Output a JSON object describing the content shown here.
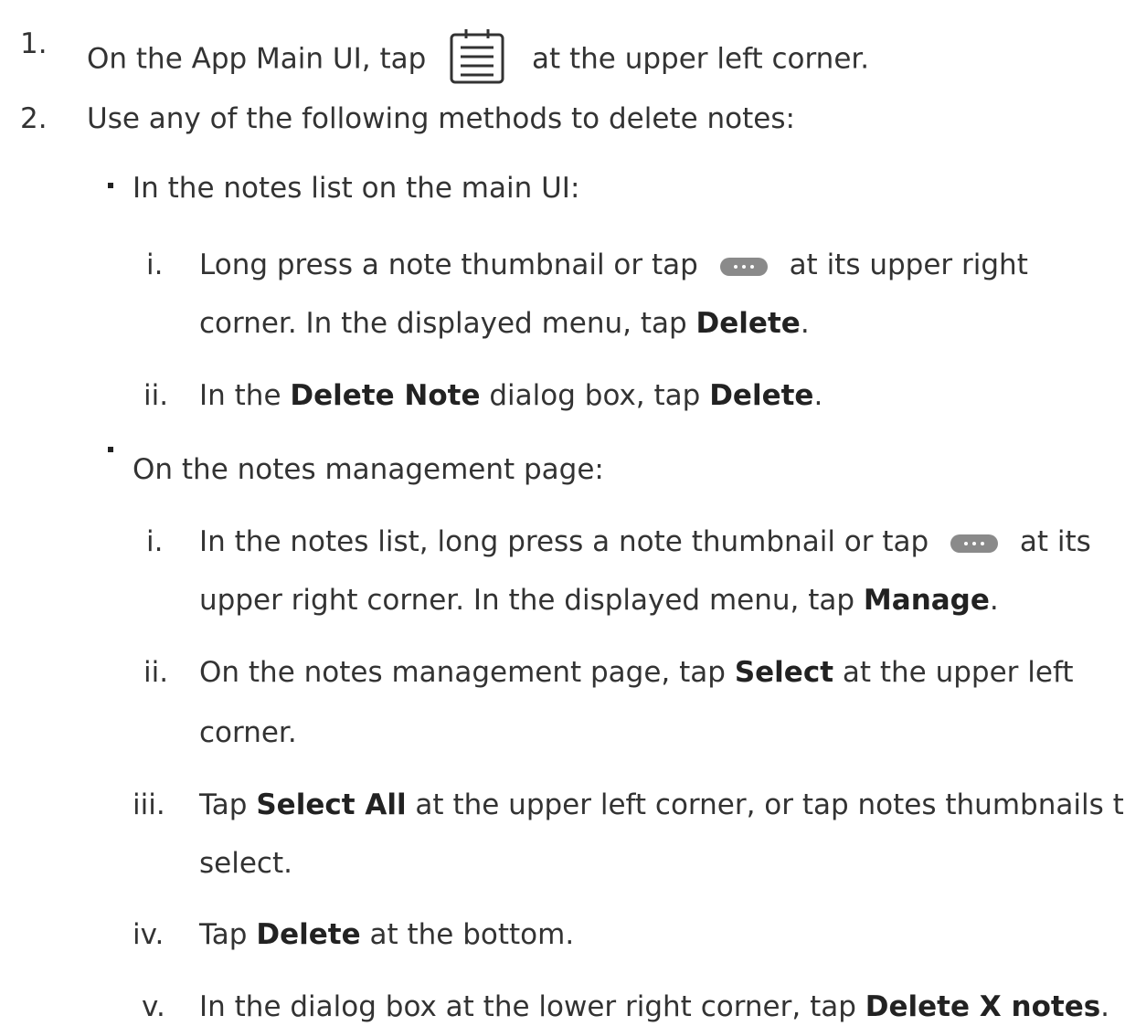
{
  "step1": {
    "num": "1.",
    "before": "On the App Main UI, tap",
    "after": "at the upper left corner.",
    "icon": "notes-list-icon"
  },
  "step2": {
    "num": "2.",
    "text": "Use any of the following methods to delete notes:"
  },
  "method1": {
    "title": "In the notes list on the main UI:",
    "i": {
      "num": "i.",
      "before": "Long press a note thumbnail or tap",
      "after": "at its upper right",
      "line2a": "corner. In the displayed menu, tap ",
      "bold": "Delete",
      "end": "."
    },
    "ii": {
      "num": "ii.",
      "a": "In the ",
      "b1": "Delete Note",
      "c": " dialog box, tap ",
      "b2": "Delete",
      "d": "."
    }
  },
  "method2": {
    "title": "On the notes management page:",
    "i": {
      "num": "i.",
      "before": "In the notes list, long press a note thumbnail or tap",
      "after": "at its",
      "line2a": "upper right corner. In the displayed menu, tap ",
      "bold": "Manage",
      "end": "."
    },
    "ii": {
      "num": "ii.",
      "a": "On the notes management page, tap ",
      "bold": "Select",
      "c": " at the upper left",
      "line2": "corner."
    },
    "iii": {
      "num": "iii.",
      "a": "Tap ",
      "bold": "Select All",
      "c": " at the upper left corner, or tap notes thumbnails to",
      "line2": "select."
    },
    "iv": {
      "num": "iv.",
      "a": "Tap ",
      "bold": "Delete",
      "c": " at the bottom."
    },
    "v": {
      "num": "v.",
      "a": "In the dialog box at the lower right corner, tap ",
      "bold": "Delete X notes",
      "c": "."
    }
  },
  "icons": {
    "more": "more-dots-icon"
  }
}
